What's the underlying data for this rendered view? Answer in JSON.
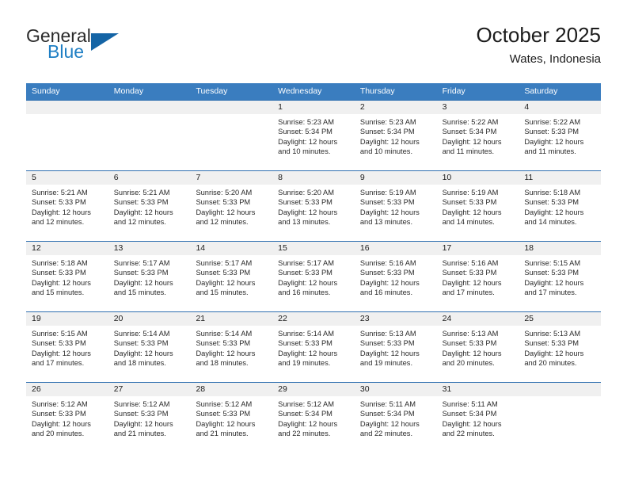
{
  "brand": {
    "name_part1": "General",
    "name_part2": "Blue",
    "triangle_color": "#1464a5",
    "blue_color": "#1f7fc4"
  },
  "header": {
    "title": "October 2025",
    "subtitle": "Wates, Indonesia"
  },
  "theme": {
    "header_bg": "#3a7dbf",
    "row_border": "#2f6fb0",
    "day_band_bg": "#f0f0f0"
  },
  "weekdays": [
    "Sunday",
    "Monday",
    "Tuesday",
    "Wednesday",
    "Thursday",
    "Friday",
    "Saturday"
  ],
  "weeks": [
    [
      {
        "day": "",
        "empty": true
      },
      {
        "day": "",
        "empty": true
      },
      {
        "day": "",
        "empty": true
      },
      {
        "day": "1",
        "sunrise": "Sunrise: 5:23 AM",
        "sunset": "Sunset: 5:34 PM",
        "daylight_line1": "Daylight: 12 hours",
        "daylight_line2": "and 10 minutes."
      },
      {
        "day": "2",
        "sunrise": "Sunrise: 5:23 AM",
        "sunset": "Sunset: 5:34 PM",
        "daylight_line1": "Daylight: 12 hours",
        "daylight_line2": "and 10 minutes."
      },
      {
        "day": "3",
        "sunrise": "Sunrise: 5:22 AM",
        "sunset": "Sunset: 5:34 PM",
        "daylight_line1": "Daylight: 12 hours",
        "daylight_line2": "and 11 minutes."
      },
      {
        "day": "4",
        "sunrise": "Sunrise: 5:22 AM",
        "sunset": "Sunset: 5:33 PM",
        "daylight_line1": "Daylight: 12 hours",
        "daylight_line2": "and 11 minutes."
      }
    ],
    [
      {
        "day": "5",
        "sunrise": "Sunrise: 5:21 AM",
        "sunset": "Sunset: 5:33 PM",
        "daylight_line1": "Daylight: 12 hours",
        "daylight_line2": "and 12 minutes."
      },
      {
        "day": "6",
        "sunrise": "Sunrise: 5:21 AM",
        "sunset": "Sunset: 5:33 PM",
        "daylight_line1": "Daylight: 12 hours",
        "daylight_line2": "and 12 minutes."
      },
      {
        "day": "7",
        "sunrise": "Sunrise: 5:20 AM",
        "sunset": "Sunset: 5:33 PM",
        "daylight_line1": "Daylight: 12 hours",
        "daylight_line2": "and 12 minutes."
      },
      {
        "day": "8",
        "sunrise": "Sunrise: 5:20 AM",
        "sunset": "Sunset: 5:33 PM",
        "daylight_line1": "Daylight: 12 hours",
        "daylight_line2": "and 13 minutes."
      },
      {
        "day": "9",
        "sunrise": "Sunrise: 5:19 AM",
        "sunset": "Sunset: 5:33 PM",
        "daylight_line1": "Daylight: 12 hours",
        "daylight_line2": "and 13 minutes."
      },
      {
        "day": "10",
        "sunrise": "Sunrise: 5:19 AM",
        "sunset": "Sunset: 5:33 PM",
        "daylight_line1": "Daylight: 12 hours",
        "daylight_line2": "and 14 minutes."
      },
      {
        "day": "11",
        "sunrise": "Sunrise: 5:18 AM",
        "sunset": "Sunset: 5:33 PM",
        "daylight_line1": "Daylight: 12 hours",
        "daylight_line2": "and 14 minutes."
      }
    ],
    [
      {
        "day": "12",
        "sunrise": "Sunrise: 5:18 AM",
        "sunset": "Sunset: 5:33 PM",
        "daylight_line1": "Daylight: 12 hours",
        "daylight_line2": "and 15 minutes."
      },
      {
        "day": "13",
        "sunrise": "Sunrise: 5:17 AM",
        "sunset": "Sunset: 5:33 PM",
        "daylight_line1": "Daylight: 12 hours",
        "daylight_line2": "and 15 minutes."
      },
      {
        "day": "14",
        "sunrise": "Sunrise: 5:17 AM",
        "sunset": "Sunset: 5:33 PM",
        "daylight_line1": "Daylight: 12 hours",
        "daylight_line2": "and 15 minutes."
      },
      {
        "day": "15",
        "sunrise": "Sunrise: 5:17 AM",
        "sunset": "Sunset: 5:33 PM",
        "daylight_line1": "Daylight: 12 hours",
        "daylight_line2": "and 16 minutes."
      },
      {
        "day": "16",
        "sunrise": "Sunrise: 5:16 AM",
        "sunset": "Sunset: 5:33 PM",
        "daylight_line1": "Daylight: 12 hours",
        "daylight_line2": "and 16 minutes."
      },
      {
        "day": "17",
        "sunrise": "Sunrise: 5:16 AM",
        "sunset": "Sunset: 5:33 PM",
        "daylight_line1": "Daylight: 12 hours",
        "daylight_line2": "and 17 minutes."
      },
      {
        "day": "18",
        "sunrise": "Sunrise: 5:15 AM",
        "sunset": "Sunset: 5:33 PM",
        "daylight_line1": "Daylight: 12 hours",
        "daylight_line2": "and 17 minutes."
      }
    ],
    [
      {
        "day": "19",
        "sunrise": "Sunrise: 5:15 AM",
        "sunset": "Sunset: 5:33 PM",
        "daylight_line1": "Daylight: 12 hours",
        "daylight_line2": "and 17 minutes."
      },
      {
        "day": "20",
        "sunrise": "Sunrise: 5:14 AM",
        "sunset": "Sunset: 5:33 PM",
        "daylight_line1": "Daylight: 12 hours",
        "daylight_line2": "and 18 minutes."
      },
      {
        "day": "21",
        "sunrise": "Sunrise: 5:14 AM",
        "sunset": "Sunset: 5:33 PM",
        "daylight_line1": "Daylight: 12 hours",
        "daylight_line2": "and 18 minutes."
      },
      {
        "day": "22",
        "sunrise": "Sunrise: 5:14 AM",
        "sunset": "Sunset: 5:33 PM",
        "daylight_line1": "Daylight: 12 hours",
        "daylight_line2": "and 19 minutes."
      },
      {
        "day": "23",
        "sunrise": "Sunrise: 5:13 AM",
        "sunset": "Sunset: 5:33 PM",
        "daylight_line1": "Daylight: 12 hours",
        "daylight_line2": "and 19 minutes."
      },
      {
        "day": "24",
        "sunrise": "Sunrise: 5:13 AM",
        "sunset": "Sunset: 5:33 PM",
        "daylight_line1": "Daylight: 12 hours",
        "daylight_line2": "and 20 minutes."
      },
      {
        "day": "25",
        "sunrise": "Sunrise: 5:13 AM",
        "sunset": "Sunset: 5:33 PM",
        "daylight_line1": "Daylight: 12 hours",
        "daylight_line2": "and 20 minutes."
      }
    ],
    [
      {
        "day": "26",
        "sunrise": "Sunrise: 5:12 AM",
        "sunset": "Sunset: 5:33 PM",
        "daylight_line1": "Daylight: 12 hours",
        "daylight_line2": "and 20 minutes."
      },
      {
        "day": "27",
        "sunrise": "Sunrise: 5:12 AM",
        "sunset": "Sunset: 5:33 PM",
        "daylight_line1": "Daylight: 12 hours",
        "daylight_line2": "and 21 minutes."
      },
      {
        "day": "28",
        "sunrise": "Sunrise: 5:12 AM",
        "sunset": "Sunset: 5:33 PM",
        "daylight_line1": "Daylight: 12 hours",
        "daylight_line2": "and 21 minutes."
      },
      {
        "day": "29",
        "sunrise": "Sunrise: 5:12 AM",
        "sunset": "Sunset: 5:34 PM",
        "daylight_line1": "Daylight: 12 hours",
        "daylight_line2": "and 22 minutes."
      },
      {
        "day": "30",
        "sunrise": "Sunrise: 5:11 AM",
        "sunset": "Sunset: 5:34 PM",
        "daylight_line1": "Daylight: 12 hours",
        "daylight_line2": "and 22 minutes."
      },
      {
        "day": "31",
        "sunrise": "Sunrise: 5:11 AM",
        "sunset": "Sunset: 5:34 PM",
        "daylight_line1": "Daylight: 12 hours",
        "daylight_line2": "and 22 minutes."
      },
      {
        "day": "",
        "empty": true
      }
    ]
  ]
}
